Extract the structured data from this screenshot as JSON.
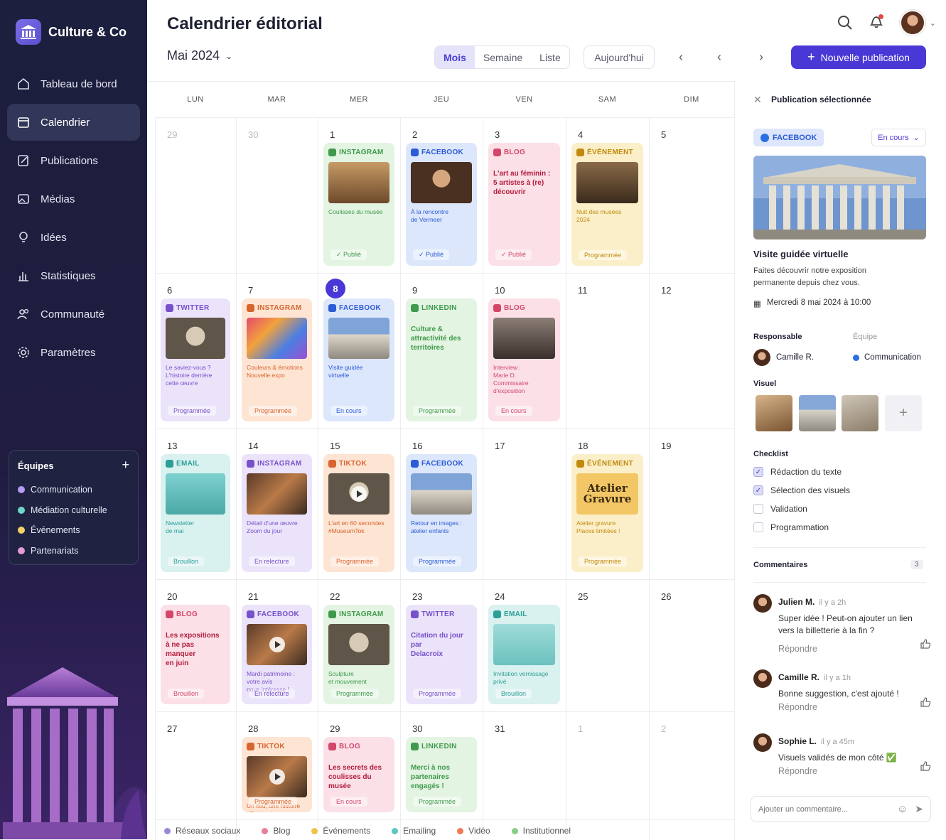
{
  "app": {
    "name": "Culture & Co"
  },
  "nav": [
    {
      "label": "Tableau de bord",
      "icon": "home-icon"
    },
    {
      "label": "Calendrier",
      "icon": "calendar-icon",
      "active": true
    },
    {
      "label": "Publications",
      "icon": "edit-icon"
    },
    {
      "label": "Médias",
      "icon": "image-icon"
    },
    {
      "label": "Idées",
      "icon": "lightbulb-icon"
    },
    {
      "label": "Statistiques",
      "icon": "chart-icon"
    },
    {
      "label": "Communauté",
      "icon": "users-icon"
    },
    {
      "label": "Paramètres",
      "icon": "gear-icon"
    }
  ],
  "teams": {
    "title": "Équipes",
    "items": [
      {
        "label": "Communication",
        "color": "#b69cf2"
      },
      {
        "label": "Médiation culturelle",
        "color": "#6fd6c7"
      },
      {
        "label": "Événements",
        "color": "#f2d16b"
      },
      {
        "label": "Partenariats",
        "color": "#e29ad8"
      }
    ]
  },
  "header": {
    "title": "Calendrier éditorial",
    "month": "Mai 2024",
    "views": [
      "Mois",
      "Semaine",
      "Liste"
    ],
    "active_view": "Mois",
    "today": "Aujourd'hui",
    "new": "Nouvelle publication"
  },
  "calendar": {
    "days": [
      "LUN",
      "MAR",
      "MER",
      "JEU",
      "VEN",
      "SAM",
      "DIM"
    ],
    "weeks": [
      [
        "29",
        "30",
        "1",
        "2",
        "3",
        "4",
        "5"
      ],
      [
        "6",
        "7",
        "8",
        "9",
        "10",
        "11",
        "12"
      ],
      [
        "13",
        "14",
        "15",
        "16",
        "17",
        "18",
        "19"
      ],
      [
        "20",
        "21",
        "22",
        "23",
        "24",
        "25",
        "26"
      ],
      [
        "27",
        "28",
        "29",
        "30",
        "31",
        "1",
        "2"
      ]
    ]
  },
  "posts": [
    {
      "w": 0,
      "d": 2,
      "type": "INSTAGRAM",
      "cap": "Coulisses du musée",
      "status": "✓ Publié",
      "k": "green",
      "img": "interior"
    },
    {
      "w": 0,
      "d": 3,
      "type": "FACEBOOK",
      "cap": "À la rencontre\nde Vermeer",
      "status": "✓ Publié",
      "k": "blue",
      "img": "portrait"
    },
    {
      "w": 0,
      "d": 4,
      "type": "BLOG",
      "big": "L'art au féminin :\n5 artistes à (re)\ndécouvrir",
      "status": "✓ Publié",
      "k": "pink"
    },
    {
      "w": 0,
      "d": 5,
      "type": "ÉVÉNEMENT",
      "cap": "Nuit des musées\n2024",
      "status": "Programmée",
      "k": "yellow",
      "img": "hall"
    },
    {
      "w": 1,
      "d": 0,
      "type": "TWITTER",
      "cap": "Le saviez-vous ?\nL'histoire derrière\ncette œuvre",
      "status": "Programmée",
      "k": "purple",
      "img": "statue"
    },
    {
      "w": 1,
      "d": 1,
      "type": "INSTAGRAM",
      "cap": "Couleurs & émotions\nNouvelle expo",
      "status": "Programmée",
      "k": "orange",
      "img": "colors"
    },
    {
      "w": 1,
      "d": 2,
      "type": "FACEBOOK",
      "cap": "Visite guidée\nvirtuelle",
      "status": "En cours",
      "k": "blue",
      "img": "building"
    },
    {
      "w": 1,
      "d": 3,
      "type": "LINKEDIN",
      "big": "Culture &\nattractivité des\nterritoires",
      "status": "Programmée",
      "k": "green"
    },
    {
      "w": 1,
      "d": 4,
      "type": "BLOG",
      "cap": "Interview :\nMarie D.\nCommissaire\nd'exposition",
      "status": "En cours",
      "k": "pink",
      "img": "gallery"
    },
    {
      "w": 2,
      "d": 0,
      "type": "EMAIL",
      "cap": "Newsletter\nde mai",
      "status": "Brouillon",
      "k": "teal",
      "img": "mail"
    },
    {
      "w": 2,
      "d": 1,
      "type": "INSTAGRAM",
      "cap": "Détail d'une œuvre\nZoom du jour",
      "status": "En relecture",
      "k": "purple",
      "img": "painting"
    },
    {
      "w": 2,
      "d": 2,
      "type": "TIKTOK",
      "cap": "L'art en 60 secondes\n#MuseumTok",
      "status": "Programmée",
      "k": "orange",
      "img": "statue",
      "play": true
    },
    {
      "w": 2,
      "d": 3,
      "type": "FACEBOOK",
      "cap": "Retour en images :\natelier enfants",
      "status": "Programmée",
      "k": "blue",
      "img": "building"
    },
    {
      "w": 2,
      "d": 5,
      "type": "ÉVÉNEMENT",
      "cap": "Atelier gravure\nPlaces limitées !",
      "status": "Programmée",
      "k": "yellow",
      "img": "atelier",
      "imgtext": "Atelier\nGravure"
    },
    {
      "w": 3,
      "d": 0,
      "type": "BLOG",
      "big": "Les expositions\nà ne pas manquer\nen juin",
      "status": "Brouillon",
      "k": "pink"
    },
    {
      "w": 3,
      "d": 1,
      "type": "FACEBOOK",
      "cap": "Mardi patrimoine :\nvotre avis\nnous intéresse !",
      "status": "En relecture",
      "k": "purple",
      "img": "painting",
      "play": true
    },
    {
      "w": 3,
      "d": 2,
      "type": "INSTAGRAM",
      "cap": "Sculpture\net mouvement",
      "status": "Programmée",
      "k": "green",
      "img": "statue"
    },
    {
      "w": 3,
      "d": 3,
      "type": "TWITTER",
      "big": "Citation du jour\npar\nDelacroix",
      "status": "Programmée",
      "k": "purple"
    },
    {
      "w": 3,
      "d": 4,
      "type": "EMAIL",
      "cap": "Invitation vernissage\nprivé",
      "status": "Brouillon",
      "k": "teal",
      "img": "mail2"
    },
    {
      "w": 4,
      "d": 1,
      "type": "TIKTOK",
      "cap": "Un lieu, une histoire\n#Patrimoine",
      "status": "Programmée",
      "k": "orange",
      "img": "painting",
      "play": true
    },
    {
      "w": 4,
      "d": 2,
      "type": "BLOG",
      "big": "Les secrets des\ncoulisses du musée",
      "status": "En cours",
      "k": "pink"
    },
    {
      "w": 4,
      "d": 3,
      "type": "LINKEDIN",
      "big": "Merci à nos\npartenaires\nengagés !",
      "status": "Programmée",
      "k": "green"
    }
  ],
  "legend": [
    {
      "label": "Réseaux sociaux",
      "color": "#9b87d6"
    },
    {
      "label": "Blog",
      "color": "#e87f9a"
    },
    {
      "label": "Événements",
      "color": "#f0c24a"
    },
    {
      "label": "Emailing",
      "color": "#5bc7c2"
    },
    {
      "label": "Vidéo",
      "color": "#ee7a52"
    },
    {
      "label": "Institutionnel",
      "color": "#86cf8a"
    }
  ],
  "panel": {
    "title": "Publication sélectionnée",
    "network": "FACEBOOK",
    "status": "En cours",
    "post_title": "Visite guidée virtuelle",
    "desc": "Faites découvrir notre exposition permanente depuis chez vous.",
    "date": "Mercredi 8 mai 2024 à 10:00",
    "resp_label": "Responsable",
    "team_label": "Équipe",
    "resp": "Camille R.",
    "team": "Communication",
    "visual_label": "Visuel",
    "checklist_label": "Checklist",
    "checklist": [
      {
        "label": "Rédaction du texte",
        "done": true
      },
      {
        "label": "Sélection des visuels",
        "done": true
      },
      {
        "label": "Validation",
        "done": false
      },
      {
        "label": "Programmation",
        "done": false
      }
    ],
    "comments_label": "Commentaires",
    "comments_count": "3",
    "comments": [
      {
        "name": "Julien M.",
        "when": "il y a 2h",
        "text": "Super idée ! Peut-on ajouter un lien vers la billetterie à la fin ?",
        "reply": "Répondre"
      },
      {
        "name": "Camille R.",
        "when": "il y a 1h",
        "text": "Bonne suggestion, c'est ajouté !",
        "reply": "Répondre"
      },
      {
        "name": "Sophie L.",
        "when": "il y a 45m",
        "text": "Visuels validés de mon côté ✅",
        "reply": "Répondre"
      }
    ],
    "comment_placeholder": "Ajouter un commentaire..."
  }
}
